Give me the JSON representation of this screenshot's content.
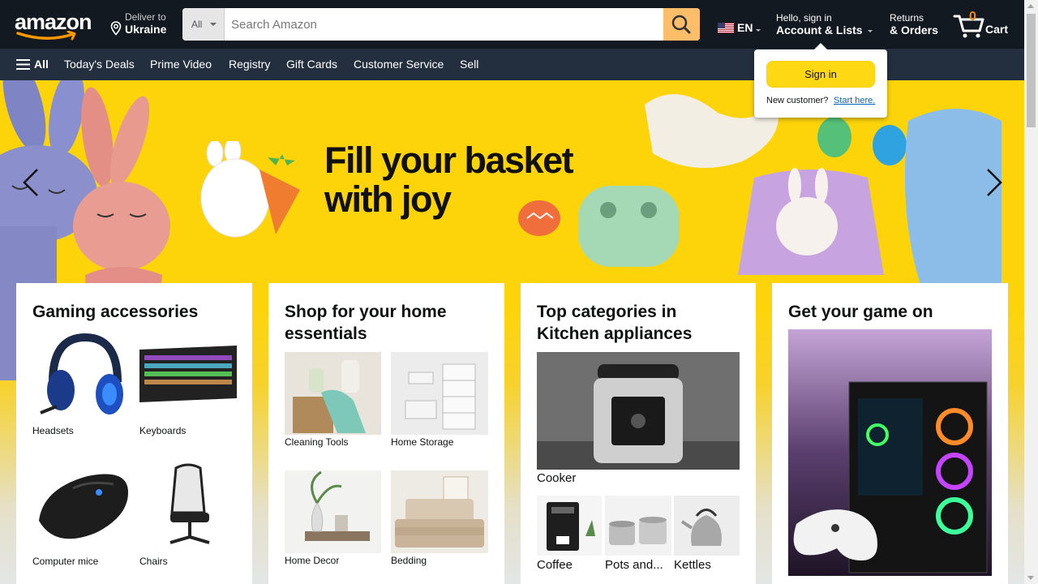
{
  "header": {
    "logo": "amazon",
    "deliver": {
      "line1": "Deliver to",
      "line2": "Ukraine"
    },
    "search": {
      "category": "All",
      "placeholder": "Search Amazon"
    },
    "language": "EN",
    "account": {
      "line1": "Hello, sign in",
      "line2": "Account & Lists"
    },
    "returns": {
      "line1": "Returns",
      "line2": "& Orders"
    },
    "cart": {
      "count": "0",
      "label": "Cart"
    }
  },
  "nav": {
    "all": "All",
    "items": [
      "Today's Deals",
      "Prime Video",
      "Registry",
      "Gift Cards",
      "Customer Service",
      "Sell"
    ]
  },
  "hero": {
    "title_line1": "Fill your basket",
    "title_line2": "with joy"
  },
  "flyout": {
    "signin": "Sign in",
    "new_customer": "New customer?",
    "start_here": "Start here."
  },
  "cards": [
    {
      "title": "Gaming accessories",
      "items": [
        "Headsets",
        "Keyboards",
        "Computer mice",
        "Chairs"
      ]
    },
    {
      "title_line1": "Shop for your home",
      "title_line2": "essentials",
      "items": [
        "Cleaning Tools",
        "Home Storage",
        "Home Decor",
        "Bedding"
      ]
    },
    {
      "title_line1": "Top categories in",
      "title_line2": "Kitchen appliances",
      "feature": "Cooker",
      "items": [
        "Coffee",
        "Pots and...",
        "Kettles"
      ]
    },
    {
      "title": "Get your game on"
    }
  ],
  "colors": {
    "nav_dark": "#131921",
    "nav_secondary": "#232f3e",
    "search_button": "#febd69",
    "cart_count": "#f08804",
    "signin_button": "#ffd814",
    "hero_bg": "#fdd40a"
  }
}
